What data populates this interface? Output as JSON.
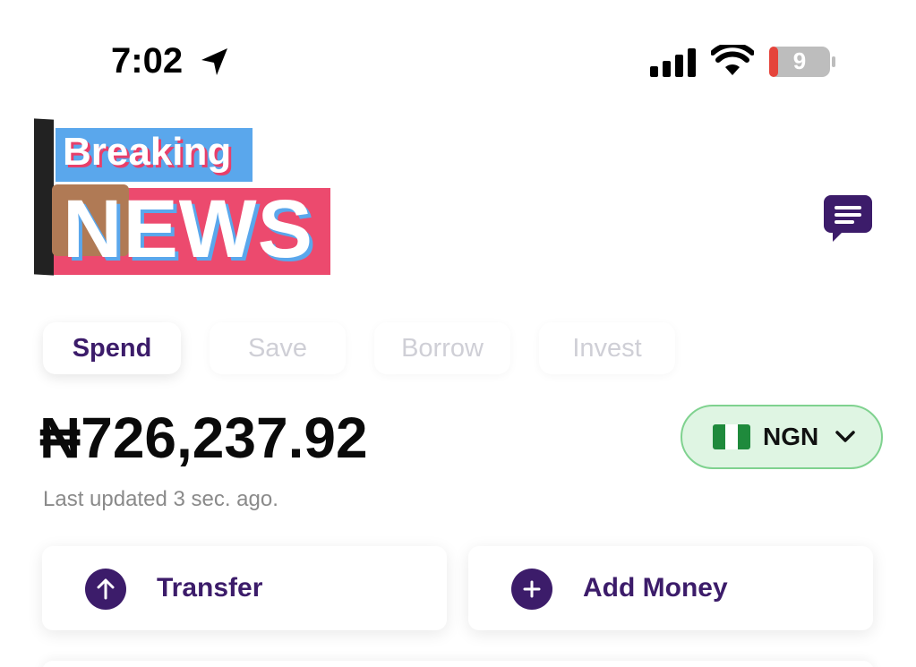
{
  "status_bar": {
    "time": "7:02",
    "battery_level": "9",
    "icons": [
      "location-arrow-icon",
      "cellular-signal-icon",
      "wifi-icon",
      "battery-icon"
    ]
  },
  "overlay": {
    "breaking": "Breaking",
    "news": "NEWS"
  },
  "header": {
    "chat_icon": "chat-bubble-icon"
  },
  "tabs": [
    {
      "label": "Spend",
      "active": true
    },
    {
      "label": "Save",
      "active": false
    },
    {
      "label": "Borrow",
      "active": false
    },
    {
      "label": "Invest",
      "active": false
    }
  ],
  "balance": {
    "amount": "₦726,237.92",
    "last_updated": "Last updated 3 sec. ago."
  },
  "currency": {
    "code": "NGN",
    "flag_icon": "nigeria-flag-icon",
    "chevron_icon": "chevron-down-icon"
  },
  "actions": [
    {
      "label": "Transfer",
      "icon": "arrow-up-icon"
    },
    {
      "label": "Add Money",
      "icon": "plus-icon"
    }
  ],
  "colors": {
    "brand_purple": "#3c1c6a",
    "pill_green_bg": "#dff5e3",
    "pill_green_border": "#7fd28f",
    "inactive_tab_text": "#cfcfd6",
    "breaking_blue": "#5aa7ec",
    "news_pink": "#ec4a6e"
  }
}
